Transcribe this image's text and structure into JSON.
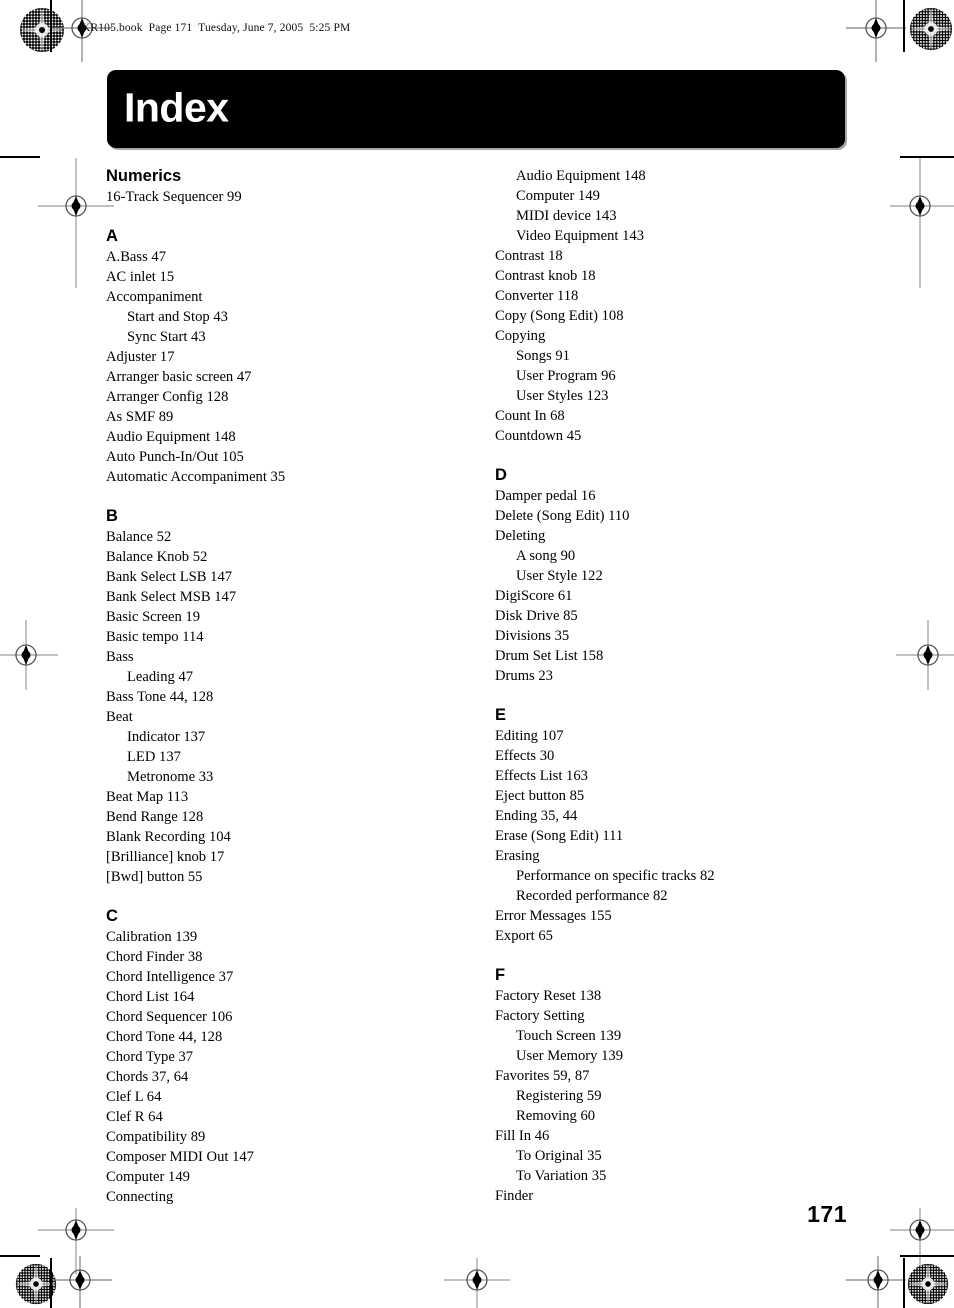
{
  "page": {
    "file_header": "KR105.book  Page 171  Tuesday, June 7, 2005  5:25 PM",
    "title": "Index",
    "page_number": "171",
    "banner_color": "#000000",
    "text_color": "#000000",
    "background_color": "#ffffff"
  },
  "columns": [
    {
      "id": "left",
      "blocks": [
        {
          "letter": "Numerics",
          "first": true,
          "entries": [
            {
              "text": "16-Track Sequencer 99",
              "level": 0
            }
          ]
        },
        {
          "letter": "A",
          "entries": [
            {
              "text": "A.Bass 47",
              "level": 0
            },
            {
              "text": "AC inlet 15",
              "level": 0
            },
            {
              "text": "Accompaniment",
              "level": 0
            },
            {
              "text": "Start and Stop 43",
              "level": 1
            },
            {
              "text": "Sync Start 43",
              "level": 1
            },
            {
              "text": "Adjuster 17",
              "level": 0
            },
            {
              "text": "Arranger basic screen 47",
              "level": 0
            },
            {
              "text": "Arranger Config 128",
              "level": 0
            },
            {
              "text": "As SMF 89",
              "level": 0
            },
            {
              "text": "Audio Equipment 148",
              "level": 0
            },
            {
              "text": "Auto Punch-In/Out 105",
              "level": 0
            },
            {
              "text": "Automatic Accompaniment 35",
              "level": 0
            }
          ]
        },
        {
          "letter": "B",
          "entries": [
            {
              "text": "Balance 52",
              "level": 0
            },
            {
              "text": "Balance Knob 52",
              "level": 0
            },
            {
              "text": "Bank Select LSB 147",
              "level": 0
            },
            {
              "text": "Bank Select MSB 147",
              "level": 0
            },
            {
              "text": "Basic Screen 19",
              "level": 0
            },
            {
              "text": "Basic tempo 114",
              "level": 0
            },
            {
              "text": "Bass",
              "level": 0
            },
            {
              "text": "Leading 47",
              "level": 1
            },
            {
              "text": "Bass Tone 44, 128",
              "level": 0
            },
            {
              "text": "Beat",
              "level": 0
            },
            {
              "text": "Indicator 137",
              "level": 1
            },
            {
              "text": "LED 137",
              "level": 1
            },
            {
              "text": "Metronome 33",
              "level": 1
            },
            {
              "text": "Beat Map 113",
              "level": 0
            },
            {
              "text": "Bend Range 128",
              "level": 0
            },
            {
              "text": "Blank Recording 104",
              "level": 0
            },
            {
              "text": "[Brilliance] knob 17",
              "level": 0
            },
            {
              "text": "[Bwd] button 55",
              "level": 0
            }
          ]
        },
        {
          "letter": "C",
          "entries": [
            {
              "text": "Calibration 139",
              "level": 0
            },
            {
              "text": "Chord Finder 38",
              "level": 0
            },
            {
              "text": "Chord Intelligence 37",
              "level": 0
            },
            {
              "text": "Chord List 164",
              "level": 0
            },
            {
              "text": "Chord Sequencer 106",
              "level": 0
            },
            {
              "text": "Chord Tone 44, 128",
              "level": 0
            },
            {
              "text": "Chord Type 37",
              "level": 0
            },
            {
              "text": "Chords 37, 64",
              "level": 0
            },
            {
              "text": "Clef L 64",
              "level": 0
            },
            {
              "text": "Clef R 64",
              "level": 0
            },
            {
              "text": "Compatibility 89",
              "level": 0
            },
            {
              "text": "Composer MIDI Out 147",
              "level": 0
            },
            {
              "text": "Computer 149",
              "level": 0
            },
            {
              "text": "Connecting",
              "level": 0
            }
          ]
        }
      ]
    },
    {
      "id": "right",
      "blocks": [
        {
          "letter": null,
          "first": true,
          "entries": [
            {
              "text": "Audio Equipment 148",
              "level": 1
            },
            {
              "text": "Computer 149",
              "level": 1
            },
            {
              "text": "MIDI device 143",
              "level": 1
            },
            {
              "text": "Video Equipment 143",
              "level": 1
            },
            {
              "text": "Contrast 18",
              "level": 0
            },
            {
              "text": "Contrast knob 18",
              "level": 0
            },
            {
              "text": "Converter 118",
              "level": 0
            },
            {
              "text": "Copy (Song Edit) 108",
              "level": 0
            },
            {
              "text": "Copying",
              "level": 0
            },
            {
              "text": "Songs 91",
              "level": 1
            },
            {
              "text": "User Program 96",
              "level": 1
            },
            {
              "text": "User Styles 123",
              "level": 1
            },
            {
              "text": "Count In 68",
              "level": 0
            },
            {
              "text": "Countdown 45",
              "level": 0
            }
          ]
        },
        {
          "letter": "D",
          "entries": [
            {
              "text": "Damper pedal 16",
              "level": 0
            },
            {
              "text": "Delete (Song Edit) 110",
              "level": 0
            },
            {
              "text": "Deleting",
              "level": 0
            },
            {
              "text": "A song 90",
              "level": 1
            },
            {
              "text": "User Style 122",
              "level": 1
            },
            {
              "text": "DigiScore 61",
              "level": 0
            },
            {
              "text": "Disk Drive 85",
              "level": 0
            },
            {
              "text": "Divisions 35",
              "level": 0
            },
            {
              "text": "Drum Set List 158",
              "level": 0
            },
            {
              "text": "Drums 23",
              "level": 0
            }
          ]
        },
        {
          "letter": "E",
          "entries": [
            {
              "text": "Editing 107",
              "level": 0
            },
            {
              "text": "Effects 30",
              "level": 0
            },
            {
              "text": "Effects List 163",
              "level": 0
            },
            {
              "text": "Eject button 85",
              "level": 0
            },
            {
              "text": "Ending 35, 44",
              "level": 0
            },
            {
              "text": "Erase (Song Edit) 111",
              "level": 0
            },
            {
              "text": "Erasing",
              "level": 0
            },
            {
              "text": "Performance on specific tracks 82",
              "level": 1
            },
            {
              "text": "Recorded performance 82",
              "level": 1
            },
            {
              "text": "Error Messages 155",
              "level": 0
            },
            {
              "text": "Export 65",
              "level": 0
            }
          ]
        },
        {
          "letter": "F",
          "entries": [
            {
              "text": "Factory Reset 138",
              "level": 0
            },
            {
              "text": "Factory Setting",
              "level": 0
            },
            {
              "text": "Touch Screen 139",
              "level": 1
            },
            {
              "text": "User Memory 139",
              "level": 1
            },
            {
              "text": "Favorites 59, 87",
              "level": 0
            },
            {
              "text": "Registering 59",
              "level": 1
            },
            {
              "text": "Removing 60",
              "level": 1
            },
            {
              "text": "Fill In 46",
              "level": 0
            },
            {
              "text": "To Original 35",
              "level": 1
            },
            {
              "text": "To Variation 35",
              "level": 1
            },
            {
              "text": "Finder",
              "level": 0
            }
          ]
        }
      ]
    }
  ],
  "print_marks": {
    "rosette_label": "print-rosette-target",
    "crosshair_label": "print-crosshair-target"
  }
}
